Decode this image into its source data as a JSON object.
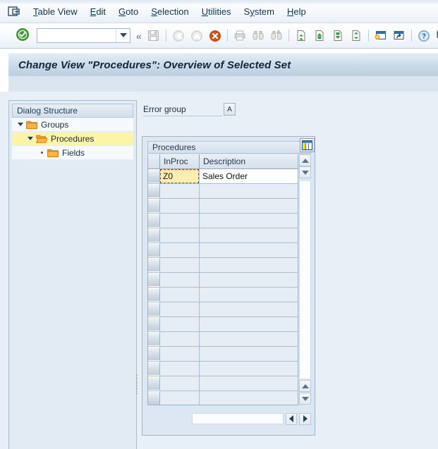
{
  "menubar": {
    "system_icon": "system-menu-icon",
    "items": [
      {
        "label": "Table View",
        "accel": "T"
      },
      {
        "label": "Edit",
        "accel": "E"
      },
      {
        "label": "Goto",
        "accel": "G"
      },
      {
        "label": "Selection",
        "accel": "S"
      },
      {
        "label": "Utilities",
        "accel": "U"
      },
      {
        "label": "System",
        "accel": "y"
      },
      {
        "label": "Help",
        "accel": "H"
      }
    ]
  },
  "toolbar": {
    "enter_icon": "green-check-icon",
    "command_field_value": "",
    "command_field_placeholder": "",
    "dropdown_icon": "chevron-down-icon",
    "collapse_icon": "double-chevron-left-icon",
    "buttons": [
      {
        "name": "save-button",
        "icon": "floppy-disk-icon",
        "enabled": false
      },
      {
        "name": "back-button",
        "icon": "double-chevron-left-circle-icon",
        "enabled": false
      },
      {
        "name": "exit-button",
        "icon": "chevron-up-circle-icon",
        "enabled": false
      },
      {
        "name": "cancel-button",
        "icon": "red-x-circle-icon",
        "enabled": true
      },
      {
        "name": "print-button",
        "icon": "printer-icon",
        "enabled": false
      },
      {
        "name": "find-button",
        "icon": "binoculars-icon",
        "enabled": false
      },
      {
        "name": "find-next-button",
        "icon": "binoculars-plus-icon",
        "enabled": false
      },
      {
        "name": "first-page-button",
        "icon": "page-first-icon",
        "enabled": true
      },
      {
        "name": "previous-page-button",
        "icon": "page-up-icon",
        "enabled": true
      },
      {
        "name": "next-page-button",
        "icon": "page-down-icon",
        "enabled": true
      },
      {
        "name": "last-page-button",
        "icon": "page-last-icon",
        "enabled": true
      },
      {
        "name": "new-session-button",
        "icon": "window-new-icon",
        "enabled": true
      },
      {
        "name": "create-shortcut-button",
        "icon": "window-shortcut-icon",
        "enabled": true
      },
      {
        "name": "help-button",
        "icon": "question-mark-circle-icon",
        "enabled": true
      },
      {
        "name": "customize-button",
        "icon": "monitor-color-icon",
        "enabled": true
      }
    ]
  },
  "title": {
    "text": "Change View \"Procedures\": Overview of Selected Set"
  },
  "tree": {
    "header": "Dialog Structure",
    "items": [
      {
        "label": "Groups",
        "level": 1,
        "twisty": "expanded",
        "folder": "folder-closed-icon",
        "selected": false
      },
      {
        "label": "Procedures",
        "level": 2,
        "twisty": "expanded",
        "folder": "folder-open-icon",
        "selected": true
      },
      {
        "label": "Fields",
        "level": 3,
        "twisty": "leaf",
        "folder": "folder-closed-icon",
        "selected": false
      }
    ]
  },
  "form": {
    "error_group_label": "Error group",
    "error_group_value": "",
    "error_group_button_label": "A",
    "error_group_button_name": "alpha-input-help-button"
  },
  "table": {
    "caption": "Procedures",
    "columns": [
      "InProc",
      "Description"
    ],
    "rows": [
      {
        "InProc": "Z0",
        "Description": "Sales Order",
        "filled": true,
        "focused_cell": "InProc"
      },
      {
        "InProc": "",
        "Description": "",
        "filled": false
      },
      {
        "InProc": "",
        "Description": "",
        "filled": false
      },
      {
        "InProc": "",
        "Description": "",
        "filled": false
      },
      {
        "InProc": "",
        "Description": "",
        "filled": false
      },
      {
        "InProc": "",
        "Description": "",
        "filled": false
      },
      {
        "InProc": "",
        "Description": "",
        "filled": false
      },
      {
        "InProc": "",
        "Description": "",
        "filled": false
      },
      {
        "InProc": "",
        "Description": "",
        "filled": false
      },
      {
        "InProc": "",
        "Description": "",
        "filled": false
      },
      {
        "InProc": "",
        "Description": "",
        "filled": false
      },
      {
        "InProc": "",
        "Description": "",
        "filled": false
      },
      {
        "InProc": "",
        "Description": "",
        "filled": false
      },
      {
        "InProc": "",
        "Description": "",
        "filled": false
      },
      {
        "InProc": "",
        "Description": "",
        "filled": false
      },
      {
        "InProc": "",
        "Description": "",
        "filled": false
      }
    ],
    "column_config_icon": "column-settings-icon",
    "scroll_up_icon": "triangle-up-icon",
    "scroll_down_icon": "triangle-down-icon",
    "scroll_left_icon": "triangle-left-icon",
    "scroll_right_icon": "triangle-right-icon"
  },
  "colors": {
    "selection_yellow": "#fcf5a9",
    "focus_red": "#e02020",
    "title_bar": "#c9d9e8",
    "folder_orange": "#f0a31e",
    "workarea": "#e9eff7"
  }
}
